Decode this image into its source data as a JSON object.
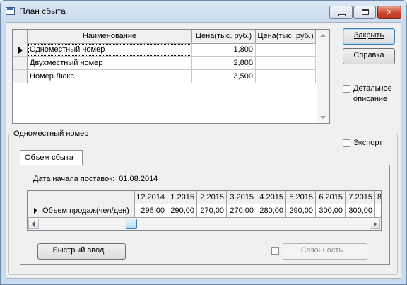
{
  "window": {
    "title": "План сбыта"
  },
  "products_grid": {
    "columns": [
      "Наименование",
      "Цена(тыс. руб.)",
      "Цена(тыс. руб.)"
    ],
    "rows": [
      {
        "name": "Одноместный номер",
        "price": "1,800",
        "price2": ""
      },
      {
        "name": "Двухместный номер",
        "price": "2,800",
        "price2": ""
      },
      {
        "name": "Номер Люкс",
        "price": "3,500",
        "price2": ""
      }
    ]
  },
  "buttons": {
    "close": "Закрыть",
    "help": "Справка",
    "quick_input": "Быстрый ввод...",
    "seasonality": "Сезонность..."
  },
  "checkboxes": {
    "detailed_line1": "Детальное",
    "detailed_line2": "описание",
    "export": "Экспорт",
    "detailed_checked": false,
    "export_checked": false,
    "seasonality_checked": false
  },
  "group": {
    "title": "Одноместный номер"
  },
  "tab": {
    "label": "Объем сбыта"
  },
  "supply": {
    "label": "Дата начала поставок:",
    "date": "01.08.2014"
  },
  "volume_grid": {
    "periods": [
      "12.2014",
      "1.2015",
      "2.2015",
      "3.2015",
      "4.2015",
      "5.2015",
      "6.2015",
      "7.2015",
      "8"
    ],
    "row_label": "Объем продаж(чел/ден)",
    "values": [
      "295,00",
      "290,00",
      "270,00",
      "270,00",
      "280,00",
      "290,00",
      "300,00",
      "300,00",
      ""
    ]
  }
}
